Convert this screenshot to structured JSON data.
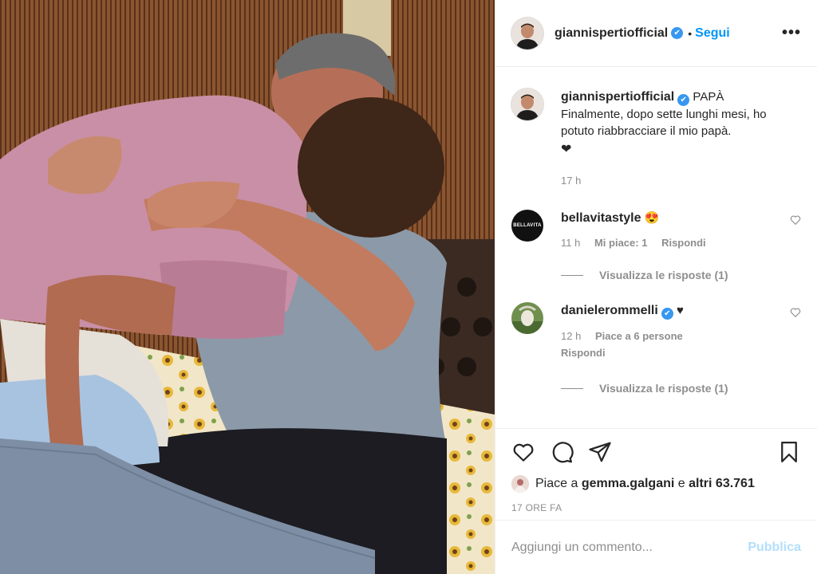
{
  "post": {
    "username": "giannispertiofficial",
    "follow_label": "Segui",
    "more_label": "•••",
    "verified_mark": "✔"
  },
  "caption": {
    "username": "giannispertiofficial",
    "text": "PAPÀ\nFinalmente, dopo sette lunghi mesi, ho potuto riabbracciare il mio papà.",
    "emoji": "❤",
    "time": "17 h"
  },
  "comments": [
    {
      "username": "bellavitastyle",
      "text": "😍",
      "time": "11 h",
      "likes": "Mi piace: 1",
      "reply_label": "Rispondi",
      "view_replies": "Visualizza le risposte (1)",
      "avatar_text": "BELLAVITA"
    },
    {
      "username": "danielerommelli",
      "text": "♥",
      "time": "12 h",
      "likes": "Piace a 6 persone",
      "reply_label": "Rispondi",
      "view_replies": "Visualizza le risposte (1)"
    }
  ],
  "actions": {
    "like_icon": "heart-outline",
    "comment_icon": "speech-bubble",
    "share_icon": "paper-plane",
    "save_icon": "bookmark"
  },
  "likes": {
    "prefix": "Piace a",
    "user": "gemma.galgani",
    "connector": "e",
    "others": "altri 63.761"
  },
  "date_label": "17 ORE FA",
  "add_comment": {
    "placeholder": "Aggiungi un commento...",
    "publish_label": "Pubblica"
  },
  "colors": {
    "accent": "#0095f6",
    "verified": "#3897f0",
    "publish_disabled": "#b2dffc",
    "secondary_text": "#8e8e8e"
  }
}
